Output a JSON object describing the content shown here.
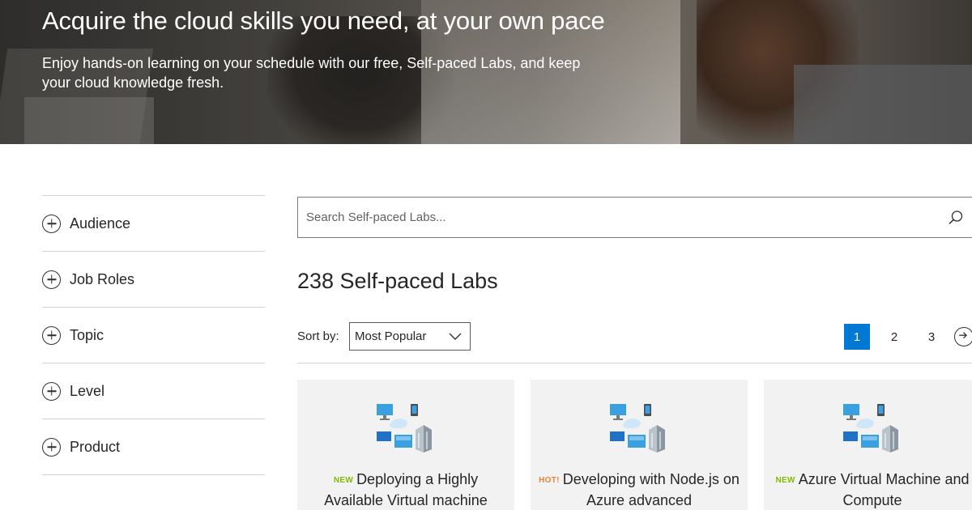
{
  "hero": {
    "title": "Acquire the cloud skills you need, at your own pace",
    "subtitle": "Enjoy hands-on learning on your schedule with our free, Self-paced Labs, and keep your cloud knowledge fresh."
  },
  "filters": [
    {
      "label": "Audience",
      "icon": "plus-circle-icon"
    },
    {
      "label": "Job Roles",
      "icon": "plus-circle-icon"
    },
    {
      "label": "Topic",
      "icon": "plus-circle-icon"
    },
    {
      "label": "Level",
      "icon": "plus-circle-icon"
    },
    {
      "label": "Product",
      "icon": "plus-circle-icon"
    }
  ],
  "search": {
    "value": "",
    "placeholder": "Search Self-paced Labs...",
    "icon": "search-icon"
  },
  "results": {
    "count_label": "238 Self-paced Labs"
  },
  "sort": {
    "label": "Sort by:",
    "selected": "Most Popular"
  },
  "pagination": {
    "pages": [
      "1",
      "2",
      "3"
    ],
    "current": "1",
    "next_icon": "arrow-right-circle-icon"
  },
  "cards": [
    {
      "badge": "NEW",
      "title": "Deploying a Highly Available Virtual machine",
      "icon": "cloud-infrastructure-icon"
    },
    {
      "badge": "HOT!",
      "title": "Developing with Node.js on Azure advanced",
      "icon": "cloud-infrastructure-icon"
    },
    {
      "badge": "NEW",
      "title": "Azure Virtual Machine and Compute",
      "icon": "cloud-infrastructure-icon"
    }
  ],
  "colors": {
    "accent": "#0078d4",
    "badge_new": "#7fba00",
    "badge_hot": "#e8833a",
    "card_bg": "#f2f2f2"
  }
}
